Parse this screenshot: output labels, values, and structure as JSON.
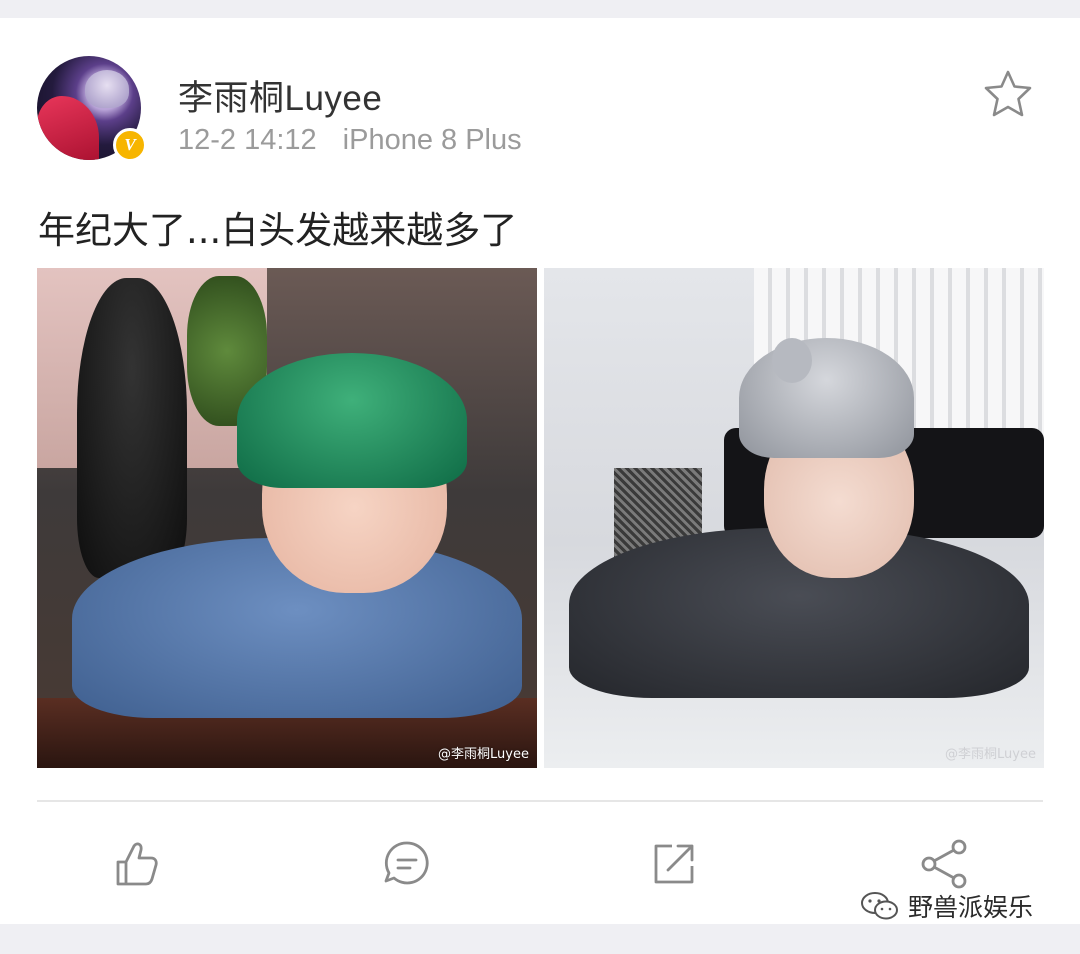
{
  "post": {
    "username": "李雨桐Luyee",
    "date": "12-2 14:12",
    "device": "iPhone 8 Plus",
    "verified_badge": "V",
    "text": "年纪大了...白头发越来越多了",
    "images": [
      {
        "watermark": "@李雨桐Luyee"
      },
      {
        "watermark": "@李雨桐Luyee"
      }
    ]
  },
  "actions": {
    "icons": [
      "star-icon",
      "like-icon",
      "comment-icon",
      "repost-icon",
      "share-icon"
    ]
  },
  "footer": {
    "brand": "野兽派娱乐"
  },
  "colors": {
    "background": "#efeff3",
    "card": "#ffffff",
    "verified": "#f7b500",
    "meta_text": "#9b9b9b",
    "icon": "#8a8a8a"
  }
}
